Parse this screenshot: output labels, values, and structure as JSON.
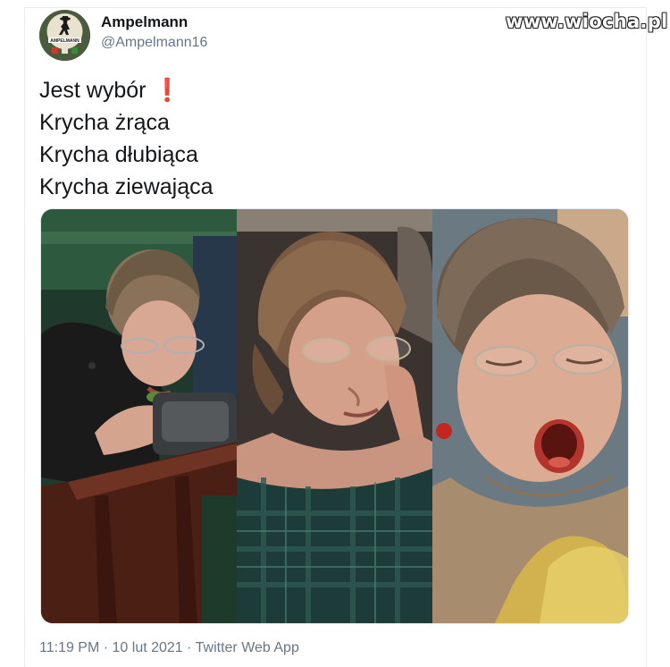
{
  "watermark": "www.wiocha.pl",
  "author": {
    "name": "Ampelmann",
    "handle": "@Ampelmann16",
    "avatar_icon": "ampelmann-figure-icon",
    "avatar_text": "AMPELMANN"
  },
  "tweet": {
    "lines": [
      "Jest wybór",
      "Krycha żrąca",
      "Krycha dłubiąca",
      "Krycha ziewająca"
    ],
    "emoji": "❗"
  },
  "media": {
    "photos": [
      "photo-eating",
      "photo-picking-nose",
      "photo-yawning"
    ]
  },
  "meta": {
    "time": "11:19 PM",
    "separator": " · ",
    "date": "10 lut 2021",
    "source": "Twitter Web App"
  },
  "colors": {
    "text": "#14171a",
    "muted": "#657786",
    "accent_red": "#e0245e"
  }
}
